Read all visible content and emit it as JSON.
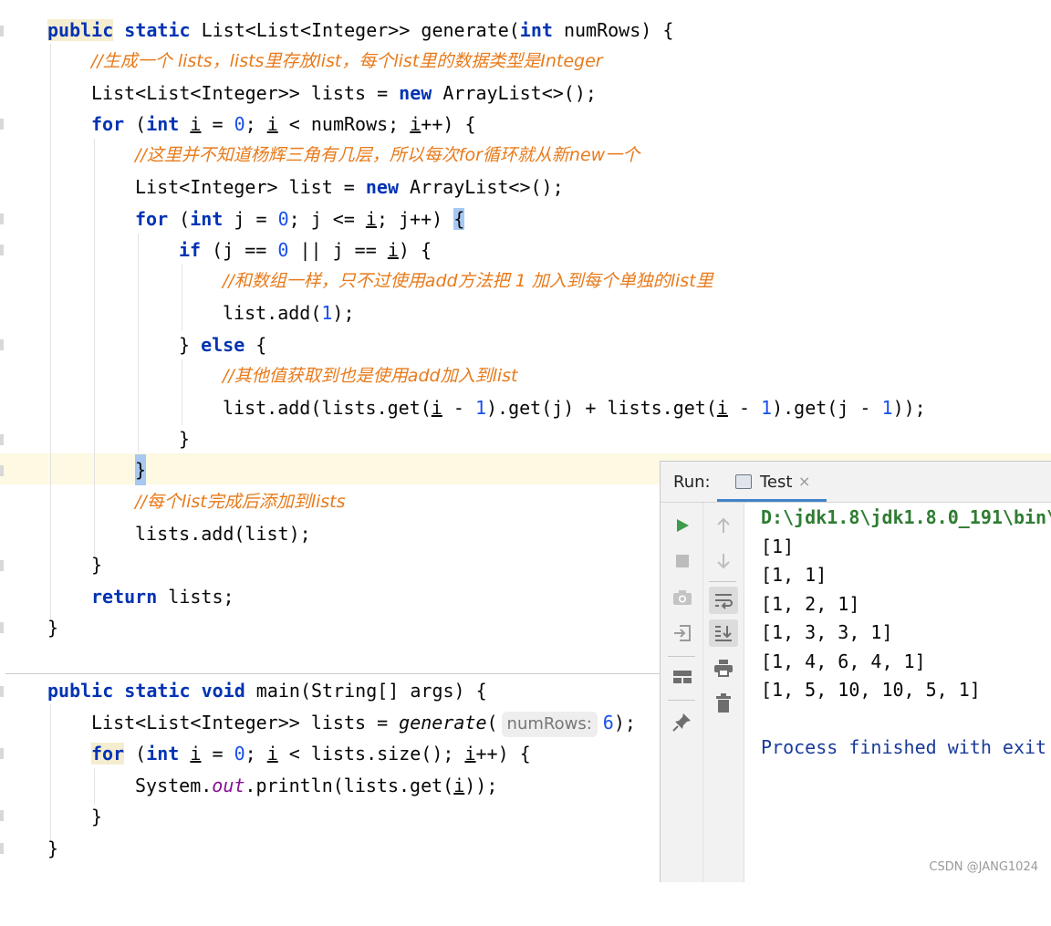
{
  "code": {
    "l1": {
      "kw1": "public",
      "kw2": "static",
      "t1": " List<List<Integer>> generate(",
      "kw3": "int",
      "t2": " numRows) {"
    },
    "l2": {
      "comment": "//生成一个 lists，lists里存放list，每个list里的数据类型是Integer"
    },
    "l3": {
      "t1": "List<List<Integer>> lists = ",
      "kw1": "new",
      "t2": " ArrayList<>();"
    },
    "l4": {
      "kw1": "for",
      "t1": " (",
      "kw2": "int",
      "t2": " ",
      "v1": "i",
      "t3": " = ",
      "n1": "0",
      "t4": "; ",
      "v2": "i",
      "t5": " < numRows; ",
      "v3": "i",
      "t6": "++) {"
    },
    "l5": {
      "comment": "//这里并不知道杨辉三角有几层，所以每次for循环就从新new一个"
    },
    "l6": {
      "t1": "List<Integer> list = ",
      "kw1": "new",
      "t2": " ArrayList<>();"
    },
    "l7": {
      "kw1": "for",
      "t1": " (",
      "kw2": "int",
      "t2": " j = ",
      "n1": "0",
      "t3": "; j <= ",
      "v1": "i",
      "t4": "; j++) ",
      "b": "{"
    },
    "l8": {
      "kw1": "if",
      "t1": " (j == ",
      "n1": "0",
      "t2": " || j == ",
      "v1": "i",
      "t3": ") {"
    },
    "l9": {
      "comment": "//和数组一样，只不过使用add方法把 1 加入到每个单独的list里"
    },
    "l10": {
      "t1": "list.add(",
      "n1": "1",
      "t2": ");"
    },
    "l11": {
      "t1": "} ",
      "kw1": "else",
      "t2": " {"
    },
    "l12": {
      "comment": "//其他值获取到也是使用add加入到list"
    },
    "l13": {
      "t1": "list.add(lists.get(",
      "v1": "i",
      "t2": " - ",
      "n1": "1",
      "t3": ").get(j) + lists.get(",
      "v2": "i",
      "t4": " - ",
      "n2": "1",
      "t5": ").get(j - ",
      "n3": "1",
      "t6": "));"
    },
    "l14": {
      "t1": "}"
    },
    "l15": {
      "b": "}"
    },
    "l16": {
      "comment": "//每个list完成后添加到lists"
    },
    "l17": {
      "t1": "lists.add(list);"
    },
    "l18": {
      "t1": "}"
    },
    "l19": {
      "kw1": "return",
      "t1": " lists;"
    },
    "l20": {
      "t1": "}"
    },
    "l21": {
      "kw1": "public",
      "kw2": "static",
      "kw3": "void",
      "t1": " main(String[] args) {"
    },
    "l22": {
      "t1": "List<List<Integer>> lists = ",
      "fn": "generate",
      "t2": "(",
      "hint": "numRows:",
      "n1": "6",
      "t3": ");"
    },
    "l23": {
      "kw1": "for",
      "t1": " (",
      "kw2": "int",
      "t2": " ",
      "v1": "i",
      "t3": " = ",
      "n1": "0",
      "t4": "; ",
      "v2": "i",
      "t5": " < lists.size(); ",
      "v3": "i",
      "t6": "++) {"
    },
    "l24": {
      "t1": "System.",
      "it": "out",
      "t2": ".println(lists.get(",
      "v1": "i",
      "t3": "));"
    },
    "l25": {
      "t1": "}"
    },
    "l26": {
      "t1": "}"
    }
  },
  "run_panel": {
    "label": "Run:",
    "tab_label": "Test",
    "tab_close": "×",
    "console_lines": [
      "D:\\jdk1.8\\jdk1.8.0_191\\bin\\",
      "[1]",
      "[1, 1]",
      "[1, 2, 1]",
      "[1, 3, 3, 1]",
      "[1, 4, 6, 4, 1]",
      "[1, 5, 10, 10, 5, 1]",
      "",
      "Process finished with exit"
    ]
  },
  "icons": [
    "rerun-icon",
    "stop-icon",
    "camera-icon",
    "login-icon",
    "layout-icon",
    "pin-icon",
    "arrow-up-icon",
    "arrow-down-icon",
    "soft-wrap-icon",
    "scroll-to-end-icon",
    "print-icon",
    "trash-icon",
    "console-tab-icon"
  ],
  "watermark": "CSDN @JANG1024",
  "colors": {
    "keyword": "#0033b3",
    "number": "#1750eb",
    "comment": "#e87a1a",
    "path": "#2f7d32",
    "process": "#1a3b9a",
    "highlight_line": "#fdf9e2"
  }
}
